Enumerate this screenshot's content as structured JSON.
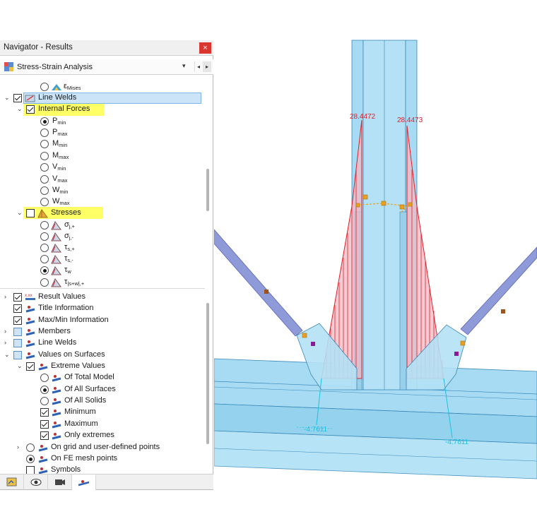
{
  "navigator": {
    "title": "Navigator - Results",
    "close": "×",
    "combo_value": "Stress-Strain Analysis",
    "combo_arrow": "▾",
    "prev": "◂",
    "next": "▸"
  },
  "tree_top": [
    {
      "text": "ε",
      "sub": "Mises"
    },
    {
      "text": "Line Welds"
    },
    {
      "text": "Internal Forces"
    }
  ],
  "internal_forces": [
    {
      "text": "P",
      "sub": "min"
    },
    {
      "text": "P",
      "sub": "max"
    },
    {
      "text": "M",
      "sub": "min"
    },
    {
      "text": "M",
      "sub": "max"
    },
    {
      "text": "V",
      "sub": "min"
    },
    {
      "text": "V",
      "sub": "max"
    },
    {
      "text": "W",
      "sub": "min"
    },
    {
      "text": "W",
      "sub": "max"
    }
  ],
  "stresses_label": "Stresses",
  "stresses": [
    {
      "text": "σ",
      "sub": "j,+"
    },
    {
      "text": "σ",
      "sub": "j,-"
    },
    {
      "text": "τ",
      "sub": "s,+"
    },
    {
      "text": "τ",
      "sub": "s,-"
    },
    {
      "text": "τ",
      "sub": "w"
    },
    {
      "text": "τ",
      "sub": "|s+w|,+"
    }
  ],
  "bottom_items": {
    "result_values": "Result Values",
    "title_information": "Title Information",
    "maxmin_information": "Max/Min Information",
    "members": "Members",
    "line_welds": "Line Welds",
    "values_on_surfaces": "Values on Surfaces",
    "extreme_values": "Extreme Values",
    "of_total_model": "Of Total Model",
    "of_all_surfaces": "Of All Surfaces",
    "of_all_solids": "Of All Solids",
    "minimum": "Minimum",
    "maximum": "Maximum",
    "only_extremes": "Only extremes",
    "on_grid_points": "On grid and user-defined points",
    "on_fe_mesh_points": "On FE mesh points",
    "symbols": "Symbols"
  },
  "result_values_icon_text": "x.xx",
  "viewport": {
    "max_left": "28.4472",
    "max_right": "28.4473",
    "min_left": "-4.7611",
    "min_right": "-4.7611",
    "colors": {
      "steel_fill": "#a9dcf3",
      "steel_edge": "#3a88b8",
      "diagram_red": "#e0202a",
      "min_cyan": "#19c3df",
      "weld_orange": "#e8a020",
      "diagonal_blue": "#8f9ad8"
    }
  }
}
